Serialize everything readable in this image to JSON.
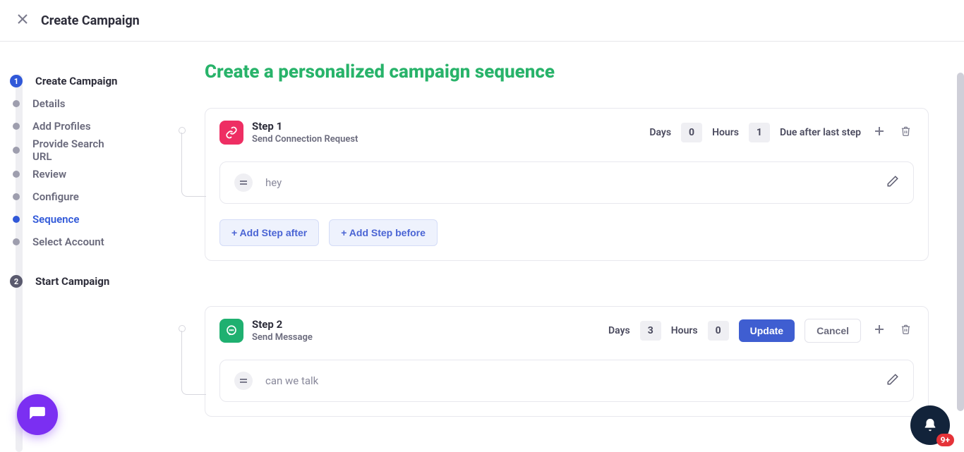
{
  "header": {
    "title": "Create Campaign"
  },
  "sidebar": {
    "group1": {
      "num": "1",
      "title": "Create Campaign",
      "items": [
        "Details",
        "Add Profiles",
        "Provide Search URL",
        "Review",
        "Configure",
        "Sequence",
        "Select Account"
      ]
    },
    "group2": {
      "num": "2",
      "title": "Start Campaign"
    }
  },
  "main": {
    "heading": "Create a personalized campaign sequence",
    "labels": {
      "days": "Days",
      "hours": "Hours",
      "due_after": "Due after last step",
      "update": "Update",
      "cancel": "Cancel",
      "add_after": "+ Add Step after",
      "add_before": "+ Add Step before"
    },
    "steps": [
      {
        "title": "Step 1",
        "subtitle": "Send Connection Request",
        "icon_color": "pink",
        "days": "0",
        "hours": "1",
        "mode": "due_after",
        "message": "hey"
      },
      {
        "title": "Step 2",
        "subtitle": "Send Message",
        "icon_color": "green",
        "days": "3",
        "hours": "0",
        "mode": "edit",
        "message": "can we talk"
      }
    ]
  },
  "notifications_badge": "9+"
}
